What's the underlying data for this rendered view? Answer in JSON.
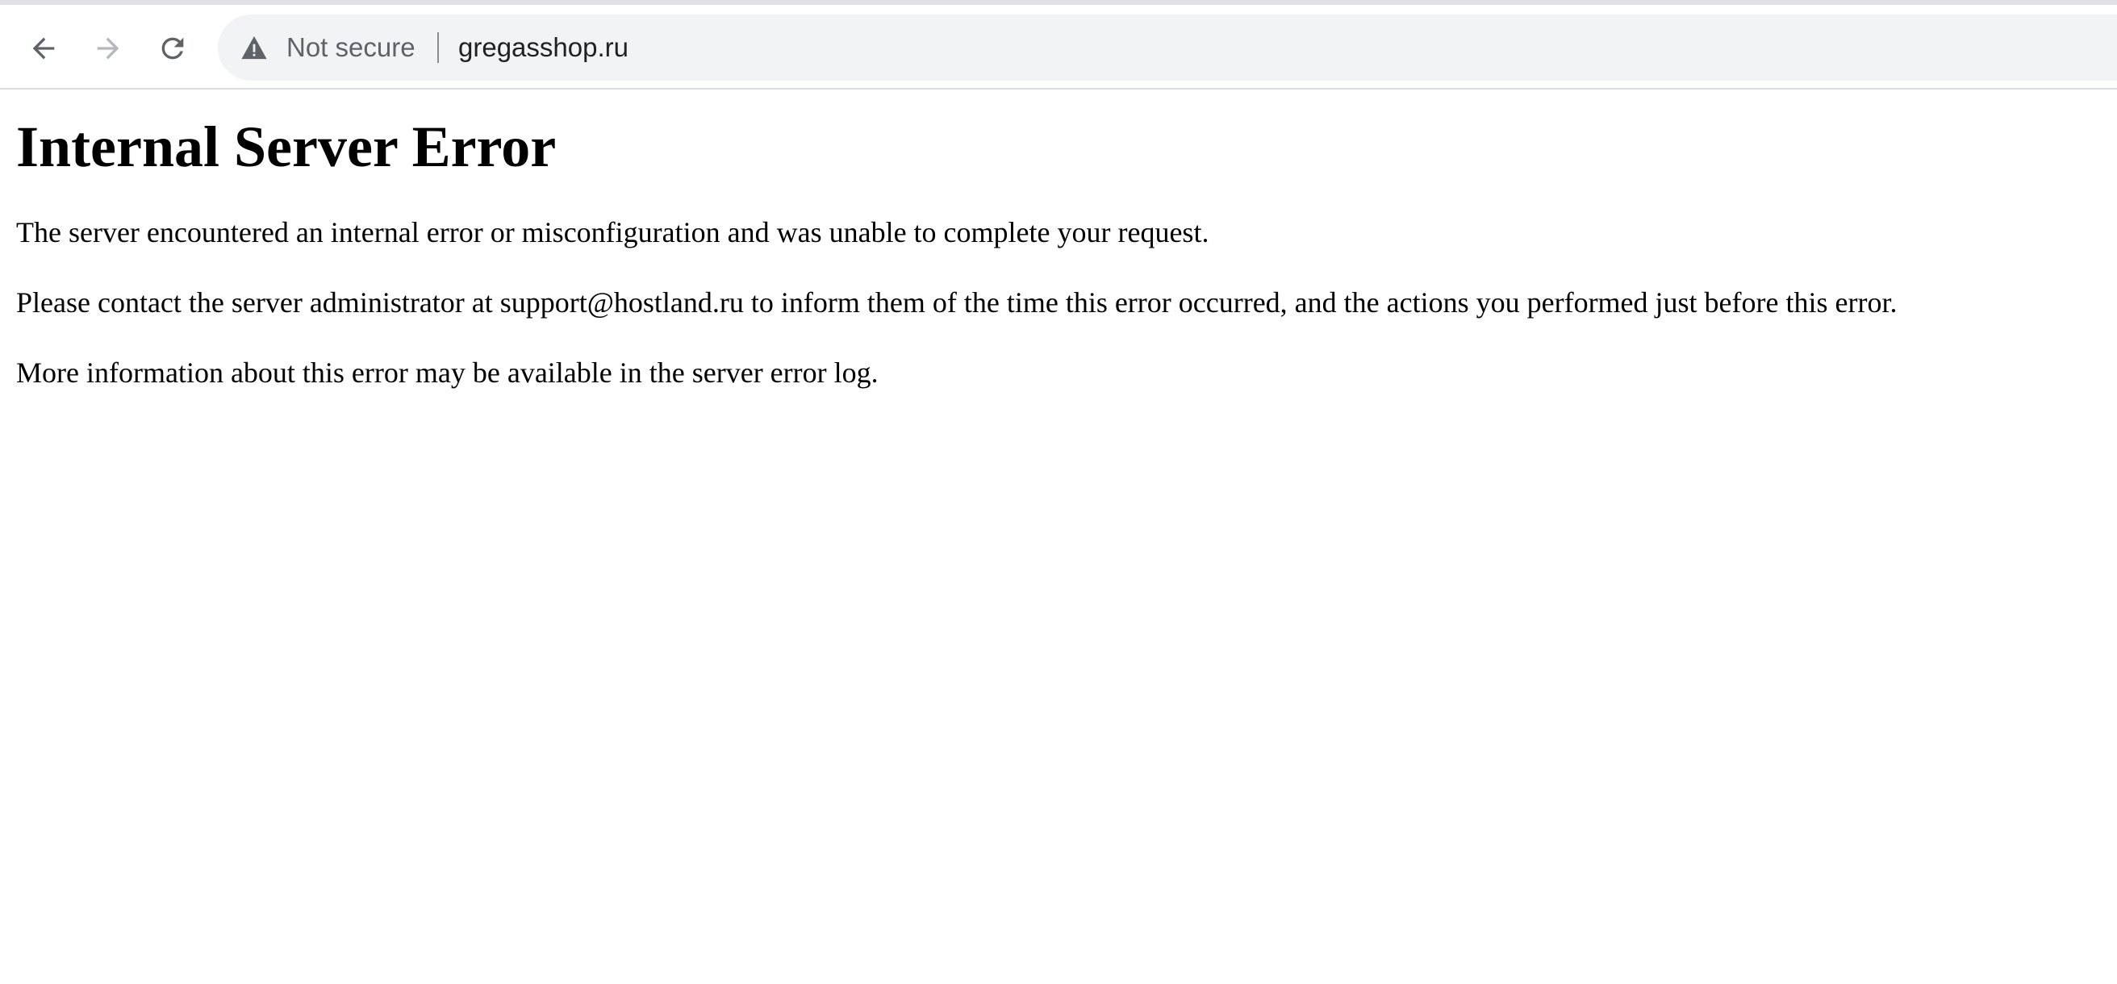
{
  "browser": {
    "security_label": "Not secure",
    "url": "gregasshop.ru",
    "icons": {
      "back": "back-arrow-icon",
      "forward": "forward-arrow-icon",
      "reload": "reload-icon",
      "security": "warning-triangle-icon"
    }
  },
  "page": {
    "heading": "Internal Server Error",
    "paragraphs": [
      "The server encountered an internal error or misconfiguration and was unable to complete your request.",
      "Please contact the server administrator at support@hostland.ru to inform them of the time this error occurred, and the actions you performed just before this error.",
      "More information about this error may be available in the server error log."
    ]
  },
  "colors": {
    "toolbar_bg": "#ffffff",
    "omnibox_bg": "#f1f3f4",
    "text": "#000000",
    "muted": "#5f6368"
  }
}
